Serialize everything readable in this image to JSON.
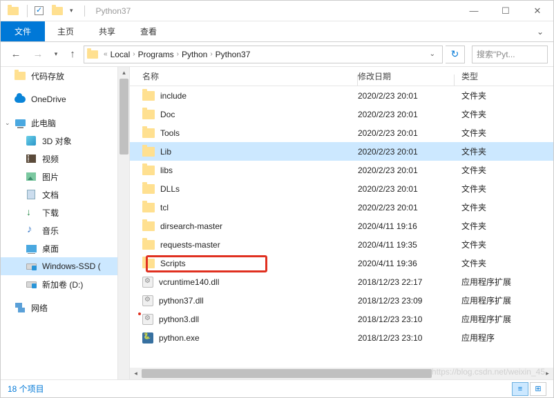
{
  "titlebar": {
    "title": "Python37"
  },
  "ribbon": {
    "file": "文件",
    "tabs": [
      "主页",
      "共享",
      "查看"
    ]
  },
  "breadcrumb": {
    "parts": [
      "Local",
      "Programs",
      "Python",
      "Python37"
    ]
  },
  "search": {
    "placeholder": "搜索\"Pyt..."
  },
  "sidebar": {
    "items": [
      {
        "label": "代码存放",
        "icon": "folder"
      },
      {
        "label": "OneDrive",
        "icon": "cloud"
      },
      {
        "label": "此电脑",
        "icon": "pc",
        "expanded": true
      },
      {
        "label": "3D 对象",
        "icon": "3d",
        "level": 2
      },
      {
        "label": "视频",
        "icon": "video",
        "level": 2
      },
      {
        "label": "图片",
        "icon": "pic",
        "level": 2
      },
      {
        "label": "文档",
        "icon": "doc",
        "level": 2
      },
      {
        "label": "下载",
        "icon": "dl",
        "level": 2
      },
      {
        "label": "音乐",
        "icon": "music",
        "level": 2
      },
      {
        "label": "桌面",
        "icon": "desk",
        "level": 2
      },
      {
        "label": "Windows-SSD (",
        "icon": "drive",
        "level": 2,
        "selected": true
      },
      {
        "label": "新加卷 (D:)",
        "icon": "drive",
        "level": 2
      },
      {
        "label": "网络",
        "icon": "net"
      }
    ]
  },
  "columns": {
    "name": "名称",
    "date": "修改日期",
    "type": "类型"
  },
  "files": [
    {
      "name": "include",
      "date": "2020/2/23 20:01",
      "type": "文件夹",
      "kind": "folder"
    },
    {
      "name": "Doc",
      "date": "2020/2/23 20:01",
      "type": "文件夹",
      "kind": "folder"
    },
    {
      "name": "Tools",
      "date": "2020/2/23 20:01",
      "type": "文件夹",
      "kind": "folder"
    },
    {
      "name": "Lib",
      "date": "2020/2/23 20:01",
      "type": "文件夹",
      "kind": "folder",
      "selected": true
    },
    {
      "name": "libs",
      "date": "2020/2/23 20:01",
      "type": "文件夹",
      "kind": "folder"
    },
    {
      "name": "DLLs",
      "date": "2020/2/23 20:01",
      "type": "文件夹",
      "kind": "folder"
    },
    {
      "name": "tcl",
      "date": "2020/2/23 20:01",
      "type": "文件夹",
      "kind": "folder"
    },
    {
      "name": "dirsearch-master",
      "date": "2020/4/11 19:16",
      "type": "文件夹",
      "kind": "folder"
    },
    {
      "name": "requests-master",
      "date": "2020/4/11 19:35",
      "type": "文件夹",
      "kind": "folder",
      "highlighted": true
    },
    {
      "name": "Scripts",
      "date": "2020/4/11 19:36",
      "type": "文件夹",
      "kind": "folder"
    },
    {
      "name": "vcruntime140.dll",
      "date": "2018/12/23 22:17",
      "type": "应用程序扩展",
      "kind": "dll"
    },
    {
      "name": "python37.dll",
      "date": "2018/12/23 23:09",
      "type": "应用程序扩展",
      "kind": "dll"
    },
    {
      "name": "python3.dll",
      "date": "2018/12/23 23:10",
      "type": "应用程序扩展",
      "kind": "dll"
    },
    {
      "name": "python.exe",
      "date": "2018/12/23 23:10",
      "type": "应用程序",
      "kind": "exe"
    }
  ],
  "status": {
    "text": "18 个项目"
  },
  "watermark": "https://blog.csdn.net/weixin_45"
}
